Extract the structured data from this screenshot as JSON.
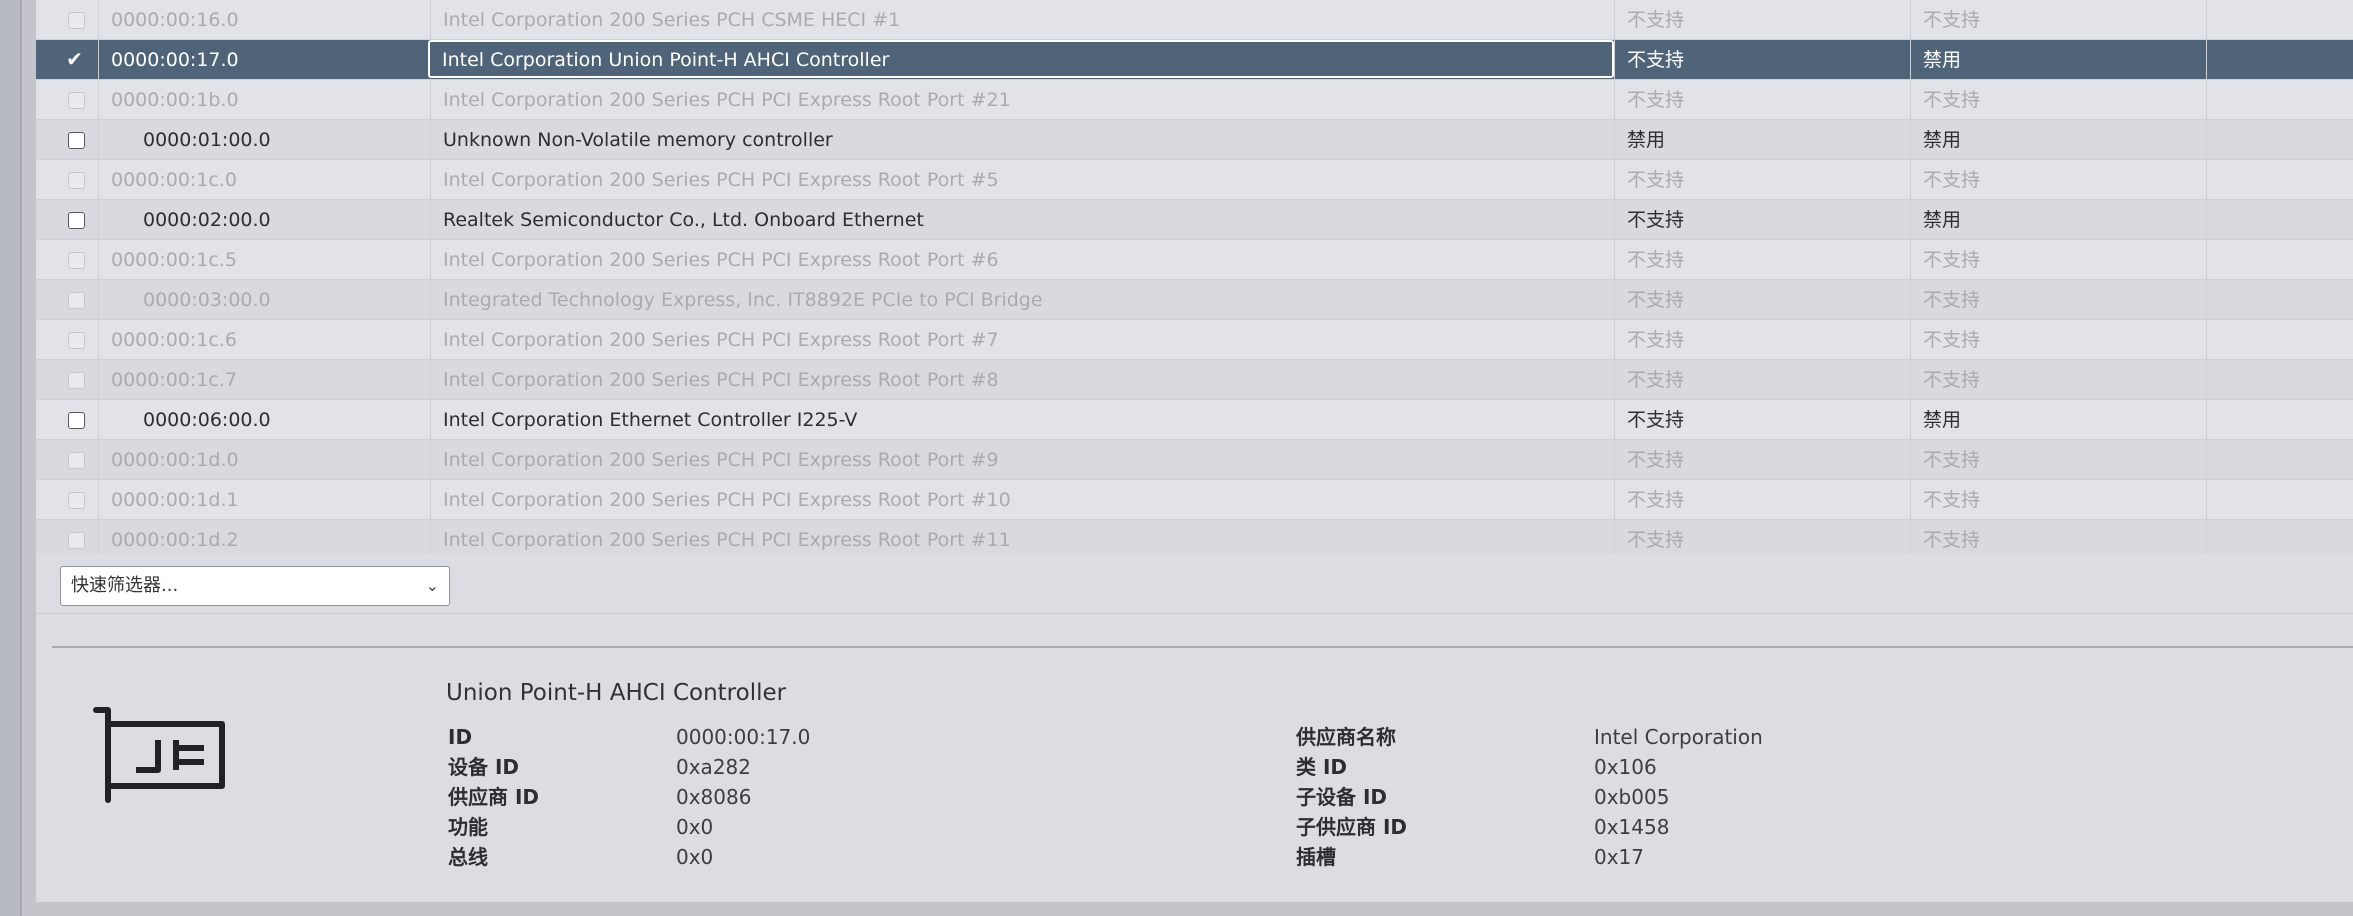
{
  "rows": [
    {
      "state": "disabled",
      "checked": false,
      "indent": false,
      "id": "0000:00:16.0",
      "name": "Intel Corporation 200 Series PCH CSME HECI #1",
      "col_a": "不支持",
      "col_b": "不支持"
    },
    {
      "state": "selected",
      "checked": true,
      "indent": false,
      "id": "0000:00:17.0",
      "name": "Intel Corporation Union Point-H AHCI Controller",
      "col_a": "不支持",
      "col_b": "禁用"
    },
    {
      "state": "disabled",
      "checked": false,
      "indent": false,
      "id": "0000:00:1b.0",
      "name": "Intel Corporation 200 Series PCH PCI Express Root Port #21",
      "col_a": "不支持",
      "col_b": "不支持"
    },
    {
      "state": "normal",
      "checked": false,
      "indent": true,
      "id": "0000:01:00.0",
      "name": "Unknown Non-Volatile memory controller",
      "col_a": "禁用",
      "col_b": "禁用"
    },
    {
      "state": "disabled",
      "checked": false,
      "indent": false,
      "id": "0000:00:1c.0",
      "name": "Intel Corporation 200 Series PCH PCI Express Root Port #5",
      "col_a": "不支持",
      "col_b": "不支持"
    },
    {
      "state": "normal",
      "checked": false,
      "indent": true,
      "id": "0000:02:00.0",
      "name": "Realtek Semiconductor Co., Ltd. Onboard Ethernet",
      "col_a": "不支持",
      "col_b": "禁用"
    },
    {
      "state": "disabled",
      "checked": false,
      "indent": false,
      "id": "0000:00:1c.5",
      "name": "Intel Corporation 200 Series PCH PCI Express Root Port #6",
      "col_a": "不支持",
      "col_b": "不支持"
    },
    {
      "state": "disabled",
      "checked": false,
      "indent": true,
      "id": "0000:03:00.0",
      "name": "Integrated Technology Express, Inc. IT8892E PCIe to PCI Bridge",
      "col_a": "不支持",
      "col_b": "不支持"
    },
    {
      "state": "disabled",
      "checked": false,
      "indent": false,
      "id": "0000:00:1c.6",
      "name": "Intel Corporation 200 Series PCH PCI Express Root Port #7",
      "col_a": "不支持",
      "col_b": "不支持"
    },
    {
      "state": "disabled",
      "checked": false,
      "indent": false,
      "id": "0000:00:1c.7",
      "name": "Intel Corporation 200 Series PCH PCI Express Root Port #8",
      "col_a": "不支持",
      "col_b": "不支持"
    },
    {
      "state": "normal",
      "checked": false,
      "indent": true,
      "id": "0000:06:00.0",
      "name": "Intel Corporation Ethernet Controller I225-V",
      "col_a": "不支持",
      "col_b": "禁用"
    },
    {
      "state": "disabled",
      "checked": false,
      "indent": false,
      "id": "0000:00:1d.0",
      "name": "Intel Corporation 200 Series PCH PCI Express Root Port #9",
      "col_a": "不支持",
      "col_b": "不支持"
    },
    {
      "state": "disabled",
      "checked": false,
      "indent": false,
      "id": "0000:00:1d.1",
      "name": "Intel Corporation 200 Series PCH PCI Express Root Port #10",
      "col_a": "不支持",
      "col_b": "不支持"
    },
    {
      "state": "disabled",
      "checked": false,
      "indent": false,
      "id": "0000:00:1d.2",
      "name": "Intel Corporation 200 Series PCH PCI Express Root Port #11",
      "col_a": "不支持",
      "col_b": "不支持"
    }
  ],
  "filter": {
    "placeholder": "快速筛选器..."
  },
  "details": {
    "title": "Union Point-H AHCI Controller",
    "left": [
      {
        "key": "ID",
        "value": "0000:00:17.0"
      },
      {
        "key": "设备 ID",
        "value": "0xa282"
      },
      {
        "key": "供应商 ID",
        "value": "0x8086"
      },
      {
        "key": "功能",
        "value": "0x0"
      },
      {
        "key": "总线",
        "value": "0x0"
      }
    ],
    "right": [
      {
        "key": "供应商名称",
        "value": "Intel Corporation"
      },
      {
        "key": "类 ID",
        "value": "0x106"
      },
      {
        "key": "子设备 ID",
        "value": "0xb005"
      },
      {
        "key": "子供应商 ID",
        "value": "0x1458"
      },
      {
        "key": "插槽",
        "value": "0x17"
      }
    ],
    "icon": "pci-card-icon"
  },
  "colors": {
    "selected_row": "#4f6478",
    "panel": "#dcdde2",
    "disabled_text": "#a7abb2"
  }
}
